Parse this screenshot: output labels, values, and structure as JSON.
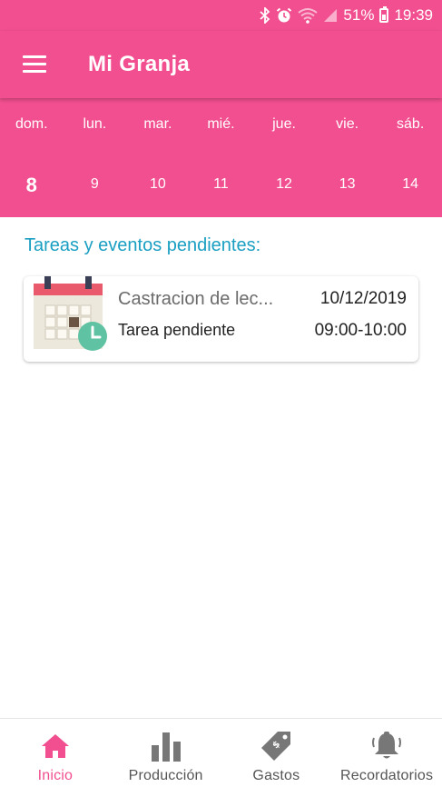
{
  "status_bar": {
    "battery": "51%",
    "time": "19:39",
    "icons": [
      "bluetooth-icon",
      "alarm-icon",
      "wifi-icon",
      "signal-icon",
      "battery-icon"
    ]
  },
  "app_bar": {
    "title": "Mi Granja",
    "menu_icon": "menu-icon"
  },
  "week": {
    "days": [
      {
        "name": "dom.",
        "num": "8",
        "today": true
      },
      {
        "name": "lun.",
        "num": "9"
      },
      {
        "name": "mar.",
        "num": "10"
      },
      {
        "name": "mié.",
        "num": "11"
      },
      {
        "name": "jue.",
        "num": "12"
      },
      {
        "name": "vie.",
        "num": "13"
      },
      {
        "name": "sáb.",
        "num": "14"
      }
    ]
  },
  "main": {
    "section_title": "Tareas y eventos pendientes:",
    "tasks": [
      {
        "title": "Castracion de lec...",
        "date": "10/12/2019",
        "status": "Tarea pendiente",
        "time": "09:00-10:00",
        "icon": "calendar-clock-icon"
      }
    ]
  },
  "bottom_nav": {
    "items": [
      {
        "label": "Inicio",
        "icon": "home-icon",
        "active": true
      },
      {
        "label": "Producción",
        "icon": "bar-chart-icon"
      },
      {
        "label": "Gastos",
        "icon": "price-tag-icon"
      },
      {
        "label": "Recordatorios",
        "icon": "bell-icon"
      }
    ]
  },
  "colors": {
    "primary": "#f14f8f",
    "section_title": "#1a9fc2",
    "calendar_header": "#e85a6c",
    "clock_badge": "#5fc3a3"
  }
}
